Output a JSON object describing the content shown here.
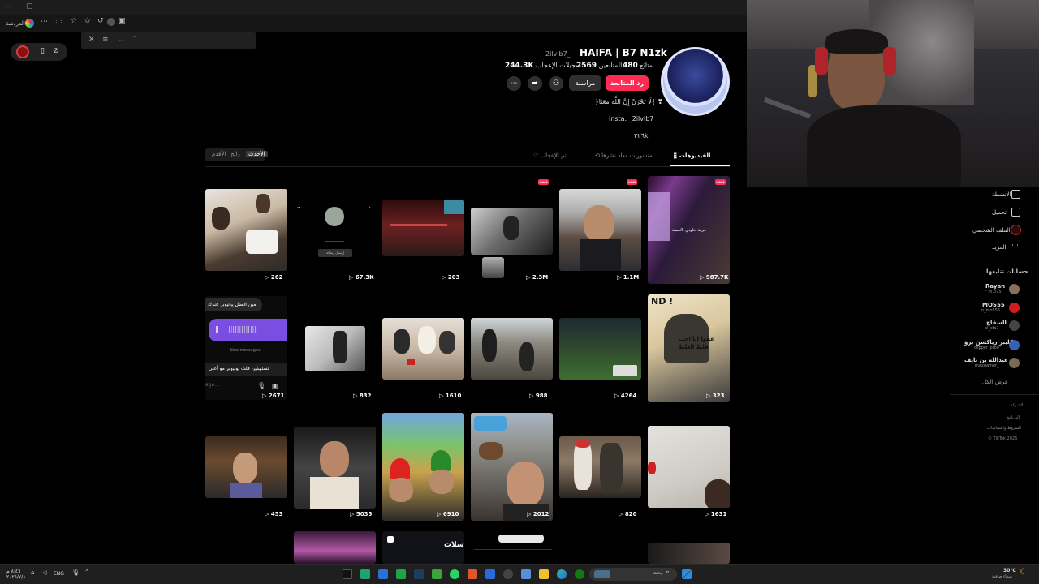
{
  "window": {
    "controls": [
      "—",
      "▢"
    ]
  },
  "browser": {
    "profile_label": "الدردشة"
  },
  "side_panel": {
    "close": "✕",
    "filter": "≡",
    "chev_down": "⌄",
    "chev_up": "⌃"
  },
  "recorder": {
    "stop": "▯",
    "pause": "⊘"
  },
  "profile": {
    "name": "HAIFA | B7 N1zk",
    "handle": "2ilvlb7_",
    "following_count": "480",
    "following_label": "متابَع",
    "followers_count": "2569",
    "followers_label": "المتابعين",
    "likes_count": "244.3K",
    "likes_label": "تسجيلات الإعجاب",
    "follow_back_button": "رد المتابعة",
    "message_button": "مراسلة",
    "bio_line1": "﴿لَا تَحْزَنْ إِنَّ اللَّهَ مَعَنَا﴾ ❣",
    "bio_line2": "insta: _2ilvlb7",
    "bio_line3": "٢٢٦k"
  },
  "tabs": {
    "videos": "الفيديوهات",
    "reposts": "منشورات معاد نشرها",
    "liked": "تم الإعجاب"
  },
  "sort": {
    "latest": "الأحدث",
    "popular": "رائج",
    "oldest": "الأقدم"
  },
  "videos": {
    "r1": [
      "262",
      "67.3K",
      "203",
      "2.3M",
      "1.1M",
      "987.7K"
    ],
    "r2": [
      "2671",
      "832",
      "1610",
      "988",
      "4264",
      "323"
    ],
    "r3": [
      "453",
      "5035",
      "6910",
      "2012",
      "820",
      "1631"
    ],
    "pinned": "مثبت",
    "r2c1_line1": "مين افضل يوتيوبر عندك",
    "r2c1_new": "New messages",
    "r2c1_line2": "تستهبلين قلت يوتيوبر مو أغني",
    "r2c1_input": "age...",
    "r1c2_btn": "إرسال رسالة",
    "r1c6_text": "غرفة خلودي بالحضة",
    "r2c6_text": "عفوا انا احب قلط الغلط",
    "r4c3_text": "سلات"
  },
  "sidebar_nav": [
    {
      "label": "الأنشطة",
      "icon": "activity-icon"
    },
    {
      "label": "تحميل",
      "icon": "upload-icon"
    },
    {
      "label": "الملف الشخصي",
      "icon": "profile-icon"
    },
    {
      "label": "المزيد",
      "icon": "more-icon"
    }
  ],
  "following": {
    "title": "حسابات تتابعها",
    "accounts": [
      {
        "name": "Rayan",
        "handle": "r_m.075",
        "color": "#8a6d5a"
      },
      {
        "name": "MOS55",
        "handle": "n_mo555",
        "color": "#d01c1c"
      },
      {
        "name": "السفاح",
        "handle": "al_sfa7",
        "color": "#444444"
      },
      {
        "name": "كليبر رياكشن برو",
        "handle": "clipper_pro0",
        "color": "#3a5fb8"
      },
      {
        "name": "عبدالله بن نايف",
        "handle": "maxgamer_",
        "color": "#7a6a55"
      }
    ],
    "see_all": "عرض الكل"
  },
  "footer_links": [
    "الشركة",
    "البرنامج",
    "الشروط والسياسات",
    "© TikTok 2026"
  ],
  "taskbar": {
    "search_placeholder": "بحث",
    "lang": "ENG",
    "time": "٨:٤٦ م",
    "date": "٢٠٢٦/٧/٨",
    "weather_temp": "30°C",
    "weather_desc": "سماء صافية"
  }
}
